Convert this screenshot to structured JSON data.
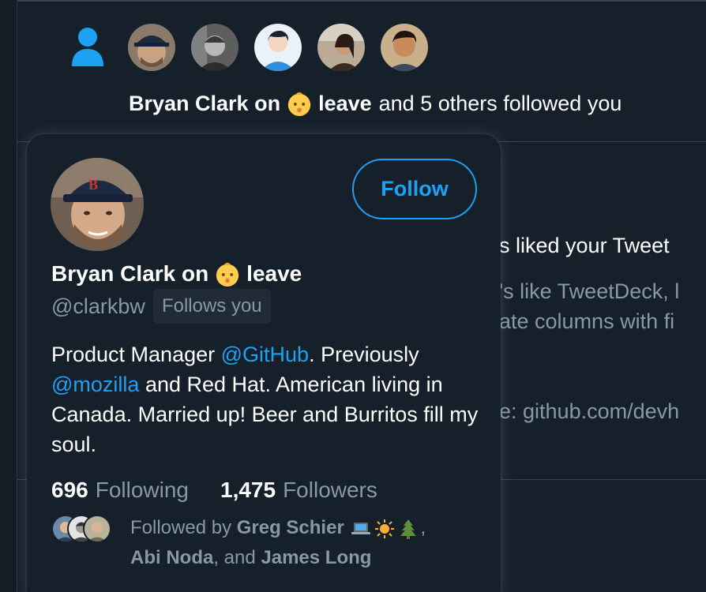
{
  "notification": {
    "icon": "person-icon",
    "avatar_count": 6,
    "actor_name_1": "Bryan Clark on",
    "actor_name_2": "leave",
    "action_text": "and 5 others followed you"
  },
  "background": {
    "liked_line": "s liked your Tweet",
    "line_1": "'s like TweetDeck, l",
    "line_2": "ate columns with fi",
    "line_3": "e: github.com/devh"
  },
  "hovercard": {
    "name_part_1": "Bryan Clark on",
    "name_part_2": "leave",
    "handle": "@clarkbw",
    "follows_you": "Follows you",
    "follow_button": "Follow",
    "bio": {
      "t1": "Product Manager ",
      "link1": "@GitHub",
      "t2": ". Previously ",
      "link2": "@mozilla",
      "t3": " and Red Hat. American living in Canada. Married up! Beer and Burritos fill my soul."
    },
    "following_count": "696",
    "following_label": "Following",
    "followers_count": "1,475",
    "followers_label": "Followers",
    "followed_by_prefix": "Followed by",
    "followed_by_1": "Greg Schier",
    "followed_by_comma": ",",
    "followed_by_2": "Abi Noda",
    "followed_by_and": ", and",
    "followed_by_3": "James Long"
  },
  "colors": {
    "background": "#15202b",
    "accent": "#1da1f2",
    "secondary_text": "#8899a6"
  }
}
